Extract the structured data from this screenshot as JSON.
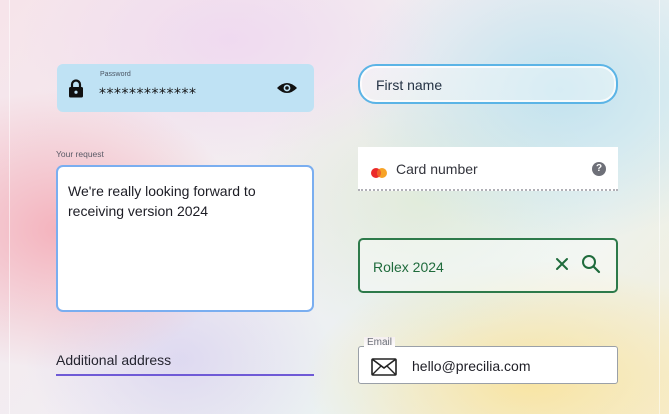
{
  "password": {
    "label": "Password",
    "value": "*************"
  },
  "first_name": {
    "placeholder": "First name"
  },
  "request": {
    "label": "Your request",
    "value": "We're really looking forward to receiving version 2024"
  },
  "card": {
    "placeholder": "Card number",
    "help_glyph": "?"
  },
  "search": {
    "value": "Rolex 2024"
  },
  "address": {
    "placeholder": "Additional address"
  },
  "email": {
    "label": "Email",
    "value": "hello@precilia.com"
  },
  "colors": {
    "password_bg": "#bfe2f4",
    "first_name_border": "#5bb4e6",
    "request_border": "#7aaef0",
    "search_accent": "#2d7a4a",
    "address_underline": "#6f5ad6",
    "mastercard_red": "#eb2a2a",
    "mastercard_orange": "#f79e1b"
  },
  "icons": [
    "lock-icon",
    "eye-icon",
    "mastercard-icon",
    "help-icon",
    "clear-icon",
    "search-icon",
    "envelope-icon"
  ]
}
